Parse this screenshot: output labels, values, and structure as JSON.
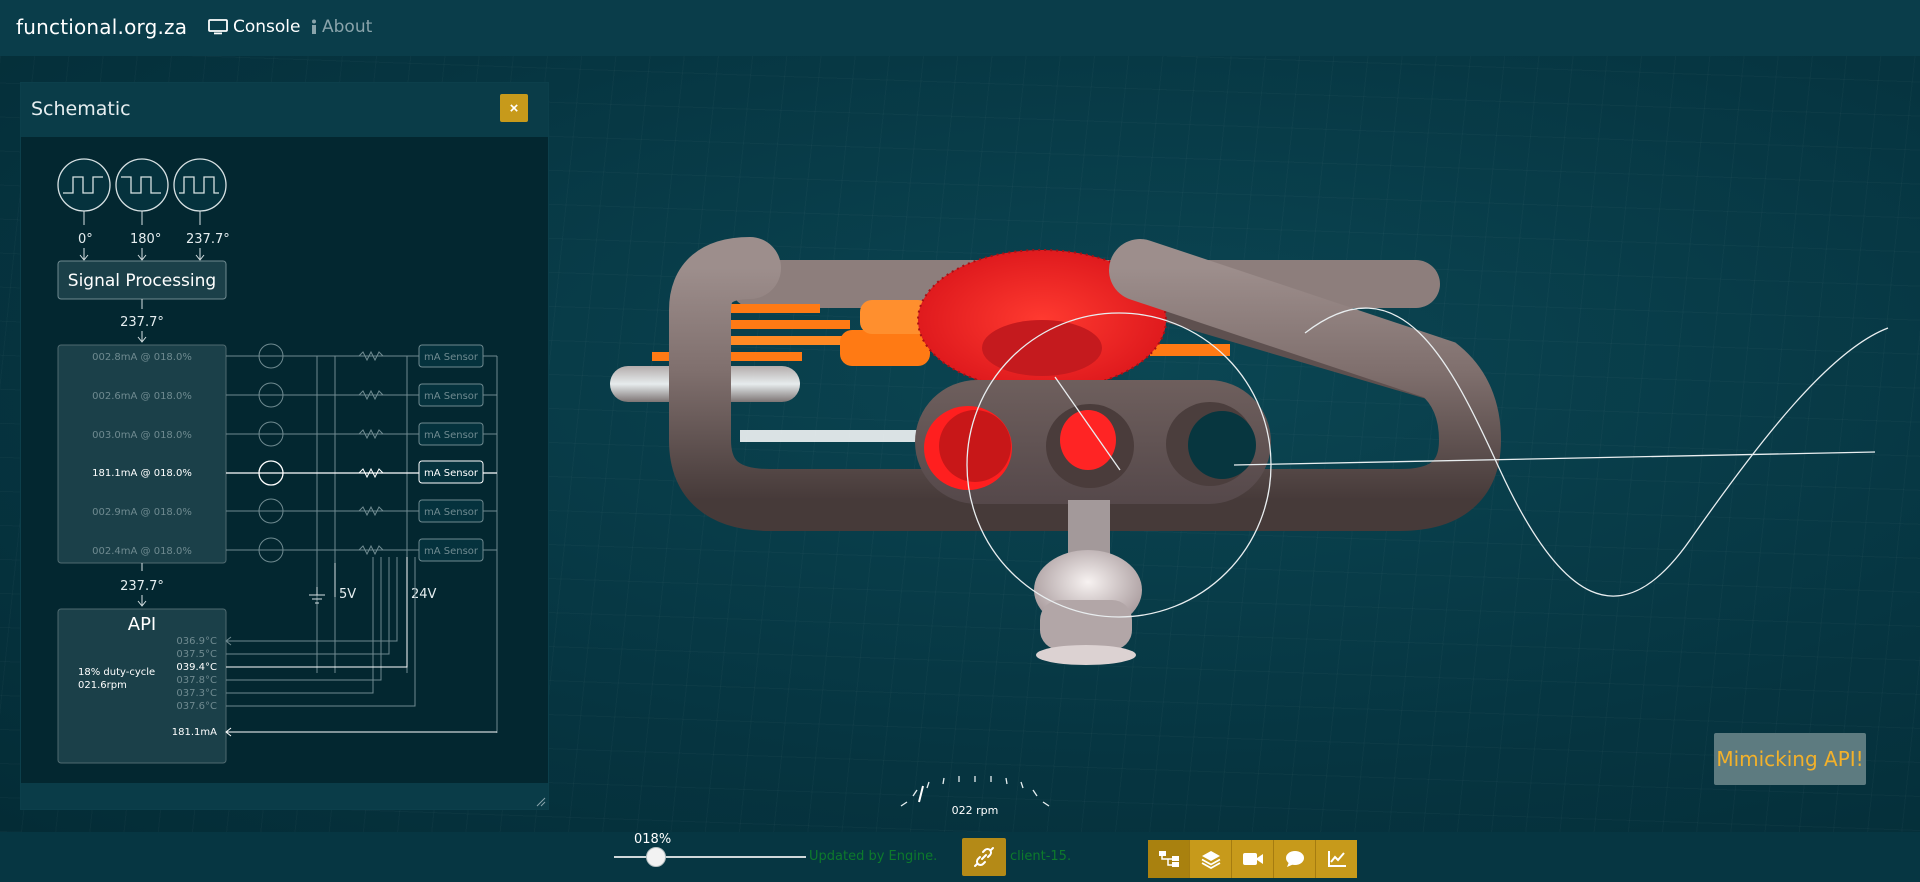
{
  "nav": {
    "brand": "functional.org.za",
    "console": "Console",
    "about": "About"
  },
  "panel": {
    "title": "Schematic",
    "close_label": "×"
  },
  "schematic": {
    "phases": [
      "0°",
      "180°",
      "237.7°"
    ],
    "signal_processing": "Signal Processing",
    "sp_out_angle": "237.7°",
    "bank_out_angle": "237.7°",
    "channels": [
      {
        "label": "002.8mA @ 018.0%",
        "active": false
      },
      {
        "label": "002.6mA @ 018.0%",
        "active": false
      },
      {
        "label": "003.0mA @ 018.0%",
        "active": false
      },
      {
        "label": "181.1mA @ 018.0%",
        "active": true
      },
      {
        "label": "002.9mA @ 018.0%",
        "active": false
      },
      {
        "label": "002.4mA @ 018.0%",
        "active": false
      }
    ],
    "sensor_label": "mA Sensor",
    "rail_5v": "5V",
    "rail_24v": "24V",
    "api": {
      "title": "API",
      "duty": "18% duty-cycle",
      "rpm": "021.6rpm",
      "temps": [
        {
          "label": "036.9°C",
          "active": false
        },
        {
          "label": "037.5°C",
          "active": false
        },
        {
          "label": "039.4°C",
          "active": true
        },
        {
          "label": "037.8°C",
          "active": false
        },
        {
          "label": "037.3°C",
          "active": false
        },
        {
          "label": "037.6°C",
          "active": false
        }
      ],
      "current": "181.1mA"
    }
  },
  "viewer": {
    "mimic_label": "Mimicking API!",
    "rpm_label": "022 rpm"
  },
  "bottombar": {
    "percent": "018%",
    "slider_value": 0.18,
    "updated_text": "Updated by Engine.",
    "client_text": "client-15.",
    "tools": [
      "schematic-icon",
      "layers-icon",
      "video-camera-icon",
      "chat-icon",
      "chart-icon"
    ]
  },
  "colors": {
    "accent": "#c79a1b",
    "status_green": "#0d7a2c",
    "mimic_text": "#f3b12a",
    "part_red": "#e8211e",
    "part_orange": "#ff7a14"
  }
}
